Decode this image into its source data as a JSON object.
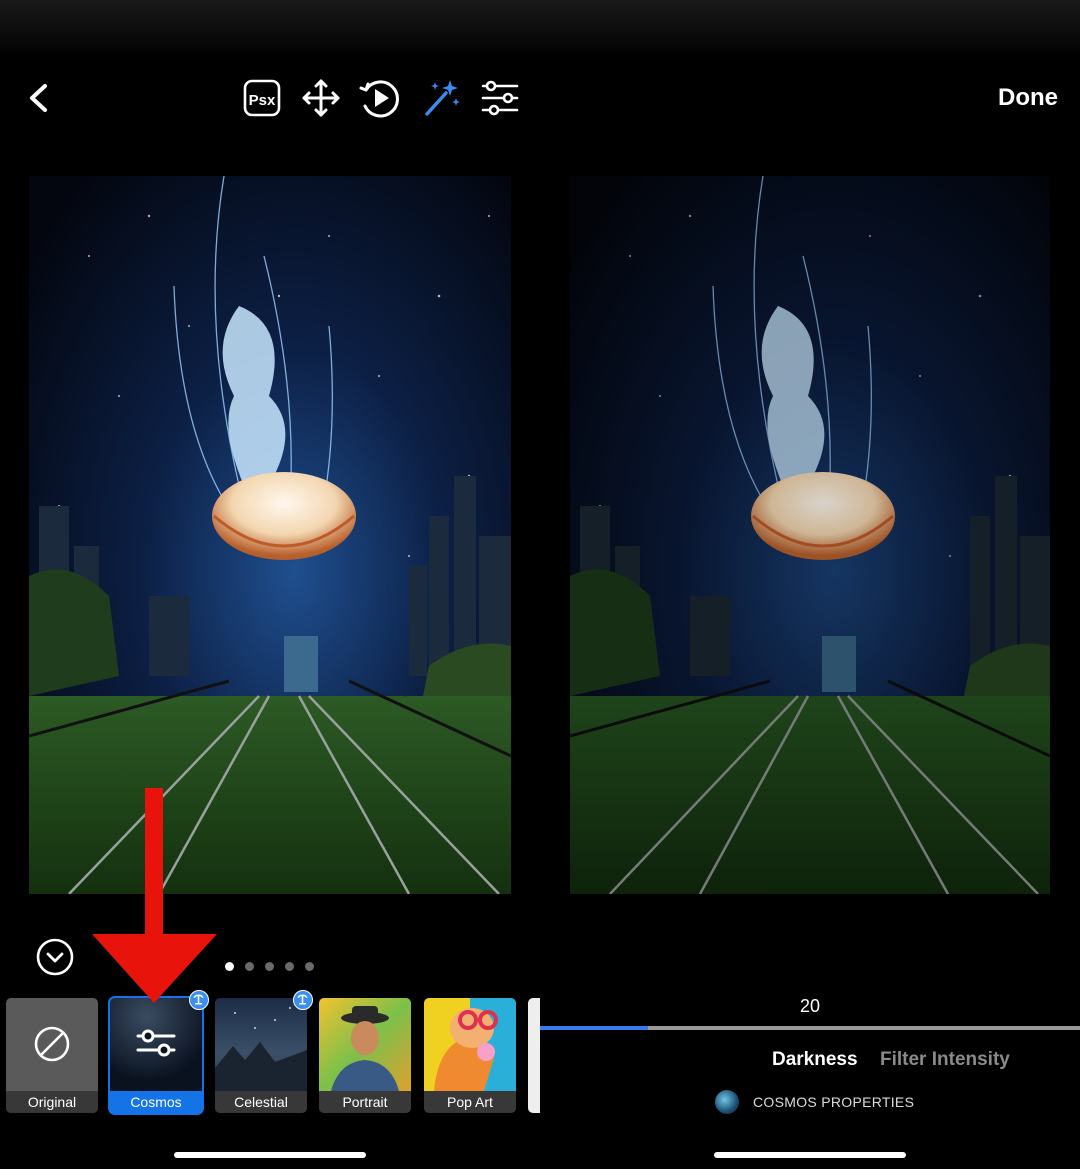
{
  "header": {
    "back_icon": "chevron-left-icon",
    "tools": [
      {
        "name": "psx-icon",
        "label": "Psx"
      },
      {
        "name": "move-icon"
      },
      {
        "name": "animate-icon"
      },
      {
        "name": "magic-wand-icon",
        "active": true
      },
      {
        "name": "adjustments-icon"
      }
    ],
    "done_label": "Done"
  },
  "preview": {
    "left_photo": "jellyfish-over-tram-tracks",
    "right_photo": "jellyfish-over-tram-tracks-darkened"
  },
  "filters": {
    "page_count": 5,
    "active_page": 0,
    "items": [
      {
        "label": "Original",
        "selected": false,
        "premium": false
      },
      {
        "label": "Cosmos",
        "selected": true,
        "premium": true
      },
      {
        "label": "Celestial",
        "selected": false,
        "premium": true
      },
      {
        "label": "Portrait",
        "selected": false,
        "premium": false
      },
      {
        "label": "Pop Art",
        "selected": false,
        "premium": false
      }
    ]
  },
  "slider": {
    "value": "20",
    "fill_fraction": 0.2
  },
  "property_tabs": [
    {
      "label": "Darkness",
      "active": true
    },
    {
      "label": "Filter Intensity",
      "active": false
    }
  ],
  "properties_label": "COSMOS PROPERTIES",
  "colors": {
    "accent": "#1473e6",
    "annotation_arrow": "#e8140c",
    "wand_active": "#3b8cf0"
  }
}
